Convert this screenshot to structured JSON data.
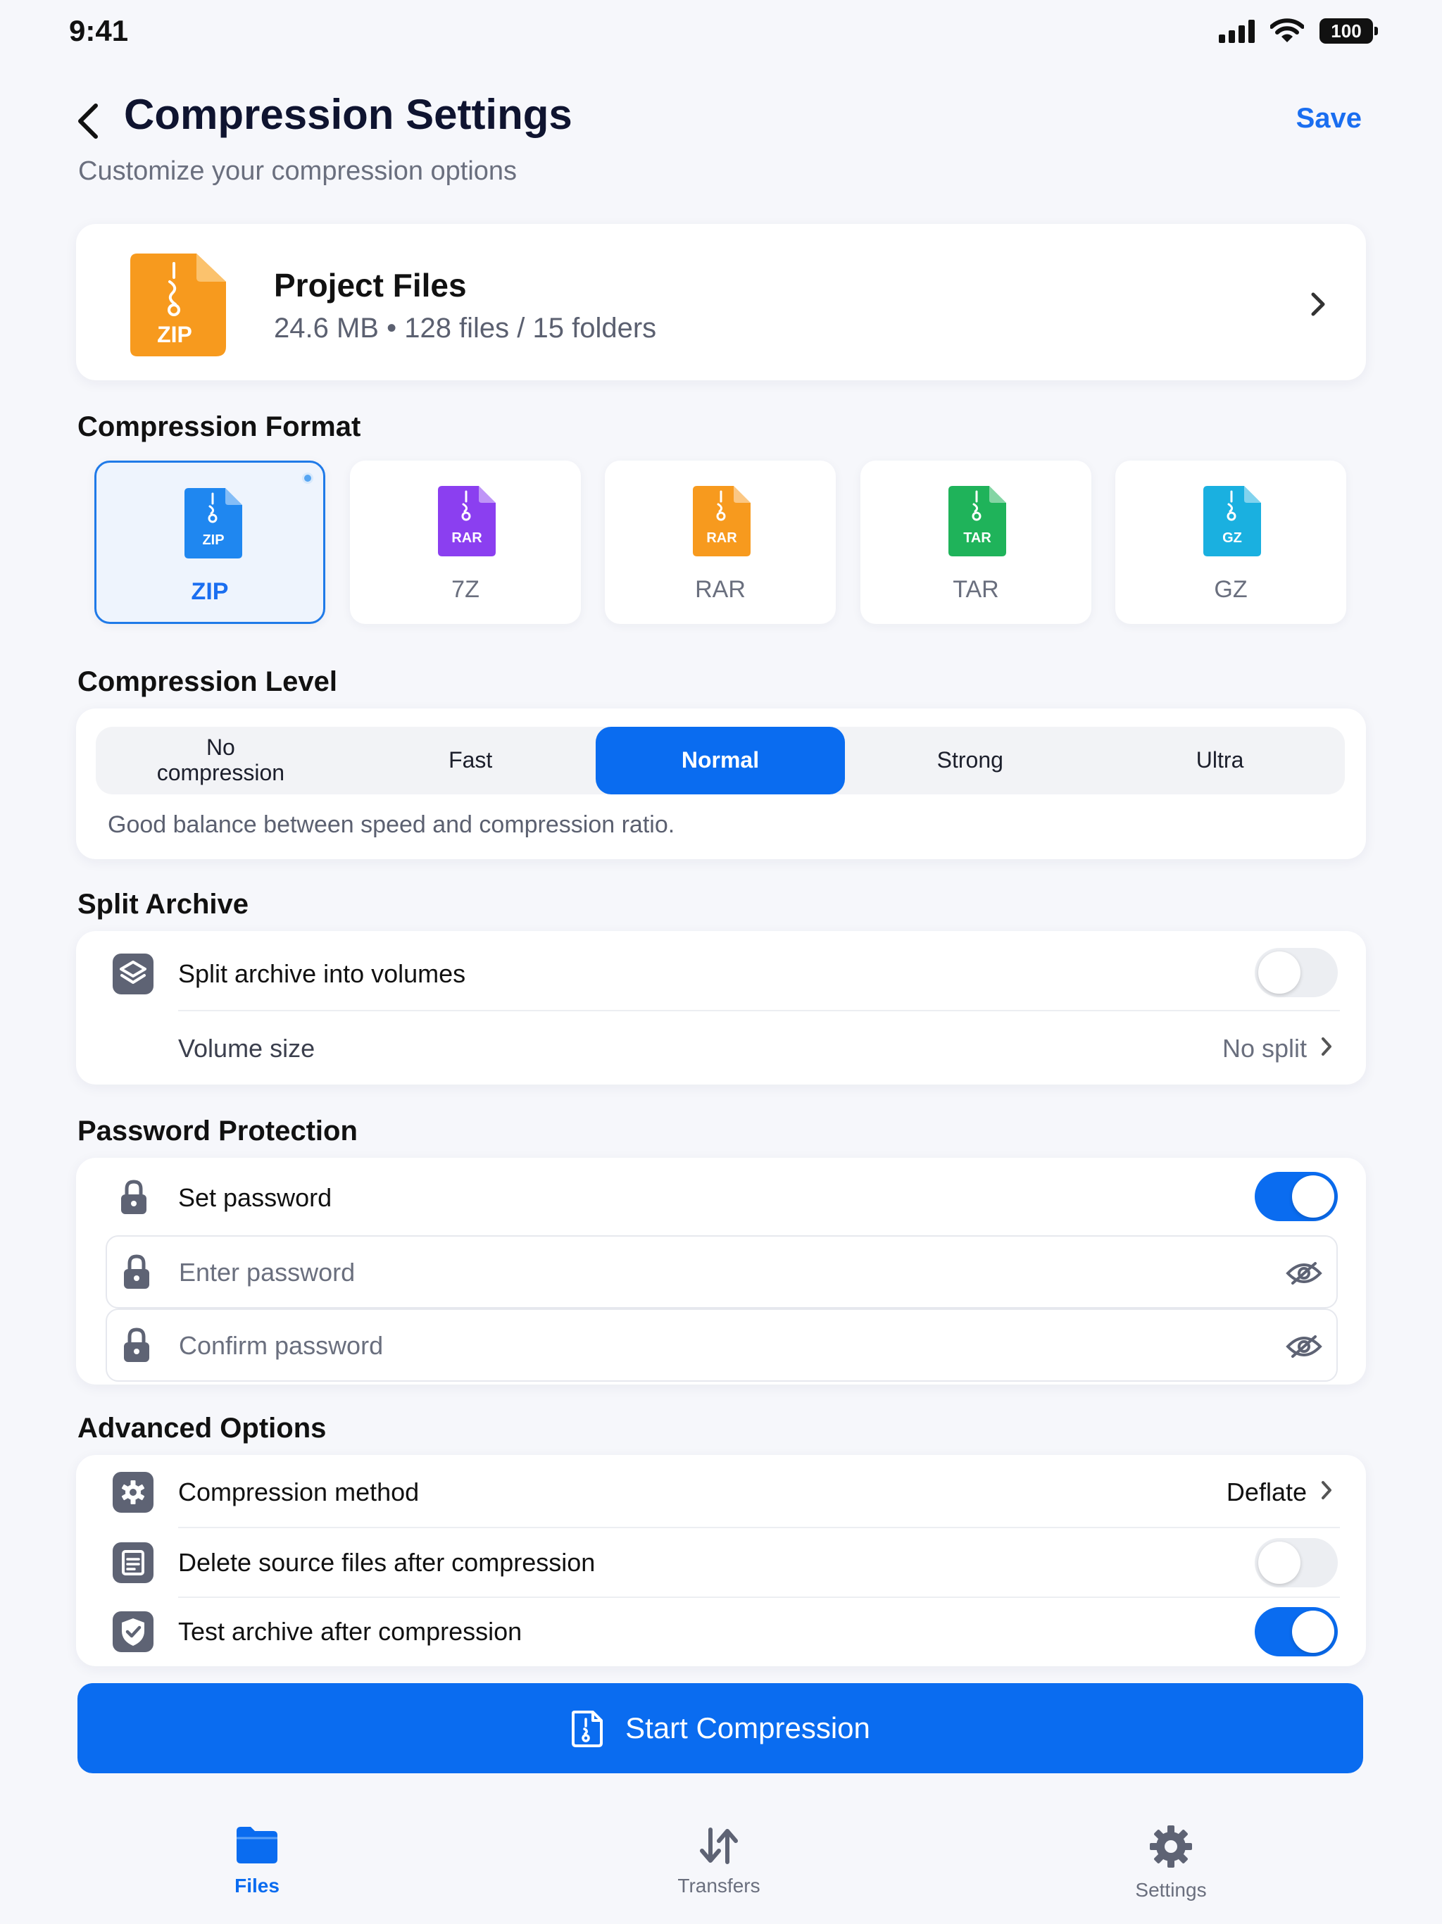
{
  "status_bar": {
    "time": "9:41",
    "battery": "100"
  },
  "header": {
    "title": "Compression Settings",
    "subtitle": "Customize your compression options",
    "save_label": "Save"
  },
  "project": {
    "icon_label": "ZIP",
    "name": "Project Files",
    "meta": "24.6 MB • 128 files / 15 folders"
  },
  "format_section": {
    "title": "Compression Format",
    "formats": [
      {
        "label": "ZIP",
        "icon_text": "ZIP",
        "color": "#1f87f0",
        "selected": true
      },
      {
        "label": "7Z",
        "icon_text": "RAR",
        "color": "#8b3ff0",
        "selected": false
      },
      {
        "label": "RAR",
        "icon_text": "RAR",
        "color": "#f79a1e",
        "selected": false
      },
      {
        "label": "TAR",
        "icon_text": "TAR",
        "color": "#1fb35a",
        "selected": false
      },
      {
        "label": "GZ",
        "icon_text": "GZ",
        "color": "#1ab0e0",
        "selected": false
      }
    ]
  },
  "level_section": {
    "title": "Compression Level",
    "options": [
      "No\ncompression",
      "Fast",
      "Normal",
      "Strong",
      "Ultra"
    ],
    "selected": "Normal",
    "description": "Good balance between speed and compression ratio."
  },
  "split_section": {
    "title": "Split Archive",
    "split_label": "Split archive into volumes",
    "split_enabled": false,
    "volume_label": "Volume size",
    "volume_value": "No split"
  },
  "password_section": {
    "title": "Password Protection",
    "set_label": "Set password",
    "set_enabled": true,
    "enter_placeholder": "Enter password",
    "confirm_placeholder": "Confirm password"
  },
  "advanced_section": {
    "title": "Advanced Options",
    "method_label": "Compression method",
    "method_value": "Deflate",
    "delete_label": "Delete source files after compression",
    "delete_enabled": false,
    "test_label": "Test archive after compression",
    "test_enabled": true
  },
  "start_button": {
    "label": "Start Compression"
  },
  "tab_bar": {
    "tabs": [
      {
        "label": "Files",
        "active": true
      },
      {
        "label": "Transfers",
        "active": false
      },
      {
        "label": "Settings",
        "active": false
      }
    ]
  },
  "colors": {
    "accent": "#0a6cf0",
    "zip_orange": "#f79a1e"
  }
}
